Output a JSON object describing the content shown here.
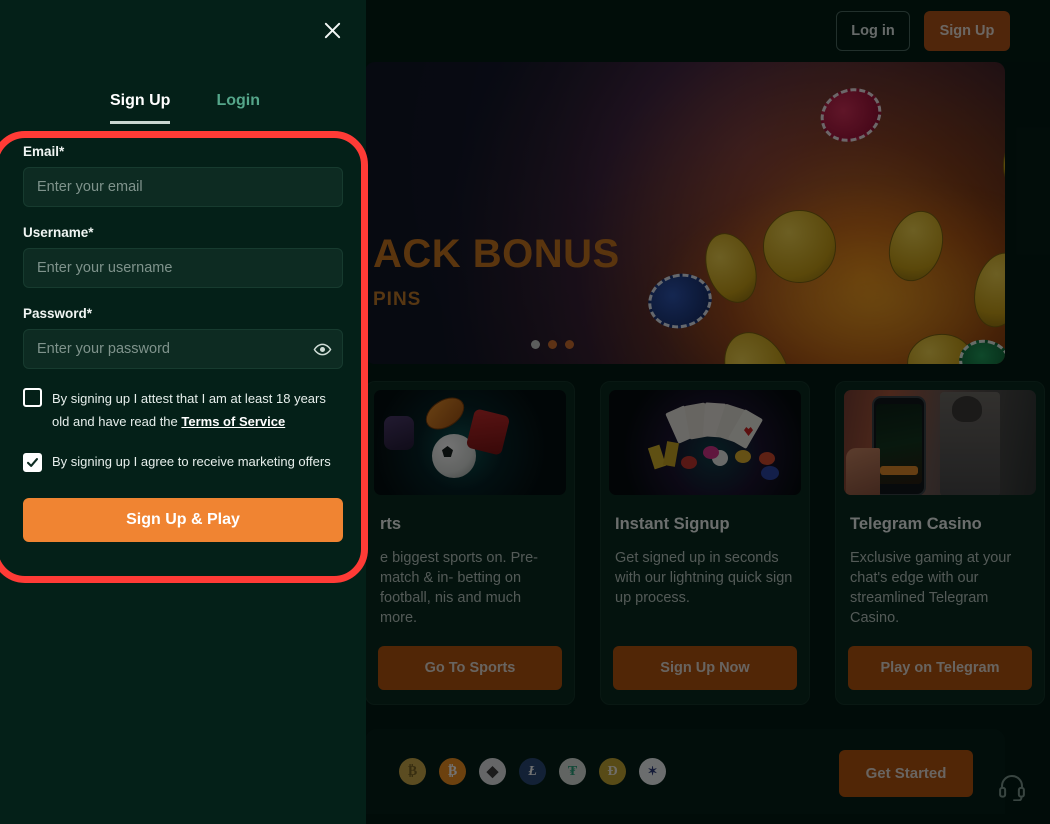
{
  "header": {
    "login_label": "Log in",
    "signup_label": "Sign Up"
  },
  "hero": {
    "title": "ACK BONUS",
    "subtitle": "PINS",
    "carousel": {
      "dots": [
        {
          "name": "dot-1",
          "color": "#c9cfcc",
          "active": true
        },
        {
          "name": "dot-2",
          "color": "#cf7030",
          "active": false
        },
        {
          "name": "dot-3",
          "color": "#cf7030",
          "active": false
        }
      ]
    }
  },
  "cards": [
    {
      "id": "sports",
      "title": "rts",
      "desc": "e biggest sports on. Pre-match & in- betting on football, nis and much more.",
      "button": "Go To Sports",
      "image_name": "sports-collage-image"
    },
    {
      "id": "instant-signup",
      "title": "Instant Signup",
      "desc": "Get signed up in seconds with our lightning quick sign up process.",
      "button": "Sign Up Now",
      "image_name": "casino-cards-chips-image"
    },
    {
      "id": "telegram-casino",
      "title": "Telegram Casino",
      "desc": "Exclusive gaming at your chat's edge with our streamlined Telegram Casino.",
      "button": "Play on Telegram",
      "image_name": "telegram-phone-image"
    }
  ],
  "crypto": {
    "coins": [
      {
        "name": "coin-bitcoin-cash",
        "symbol": "₿",
        "bg": "#c9a84a",
        "fg": "#7a6524"
      },
      {
        "name": "coin-bitcoin",
        "symbol": "₿",
        "bg": "#f09022",
        "fg": "#ffffff"
      },
      {
        "name": "coin-ethereum",
        "symbol": "♦",
        "bg": "#dfe2e5",
        "fg": "#3c3c3d"
      },
      {
        "name": "coin-litecoin",
        "symbol": "Ł",
        "bg": "#2a4b78",
        "fg": "#ffffff"
      },
      {
        "name": "coin-tether",
        "symbol": "₮",
        "bg": "#d7ddd9",
        "fg": "#26a17b"
      },
      {
        "name": "coin-dogecoin",
        "symbol": "Ð",
        "bg": "#c4a634",
        "fg": "#f6f2e4"
      },
      {
        "name": "coin-cardano",
        "symbol": "✦",
        "bg": "#eef1f4",
        "fg": "#2b3b7a"
      }
    ],
    "get_started_label": "Get Started",
    "support_icon": "headset-icon"
  },
  "modal": {
    "close_icon": "close-icon",
    "tabs": [
      {
        "id": "signup",
        "label": "Sign Up",
        "active": true
      },
      {
        "id": "login",
        "label": "Login",
        "active": false
      }
    ],
    "fields": {
      "email": {
        "label": "Email",
        "required_mark": "*",
        "placeholder": "Enter your email",
        "value": ""
      },
      "username": {
        "label": "Username",
        "required_mark": "*",
        "placeholder": "Enter your username",
        "value": ""
      },
      "password": {
        "label": "Password",
        "required_mark": "*",
        "placeholder": "Enter your password",
        "value": "",
        "toggle_icon": "eye-icon"
      }
    },
    "checkboxes": [
      {
        "id": "age-terms",
        "checked": false,
        "text_before": "By signing up I attest that I am at least 18 years old and have read the ",
        "link_text": "Terms of Service"
      },
      {
        "id": "marketing",
        "checked": true,
        "text_before": "By signing up I agree to receive marketing offers",
        "link_text": ""
      }
    ],
    "submit_label": "Sign Up & Play"
  },
  "colors": {
    "accent_orange": "#f08432",
    "button_orange": "#b4540f",
    "page_bg": "#041c16",
    "modal_bg": "#042018",
    "highlight_red": "#ff3b36",
    "tab_inactive": "#55a68a"
  }
}
